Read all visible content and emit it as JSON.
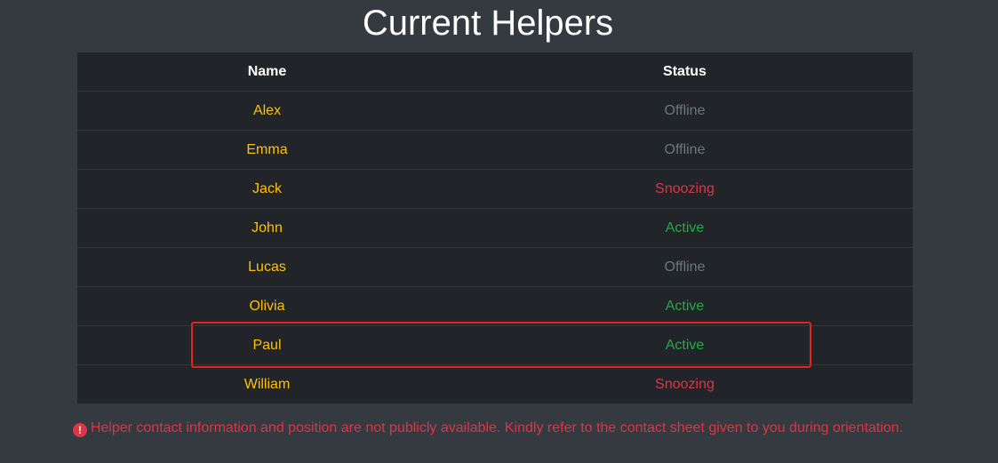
{
  "page": {
    "title": "Current Helpers"
  },
  "table": {
    "headers": {
      "name": "Name",
      "status": "Status"
    },
    "rows": [
      {
        "name": "Alex",
        "status": "Offline",
        "status_type": "offline"
      },
      {
        "name": "Emma",
        "status": "Offline",
        "status_type": "offline"
      },
      {
        "name": "Jack",
        "status": "Snoozing",
        "status_type": "snoozing"
      },
      {
        "name": "John",
        "status": "Active",
        "status_type": "active"
      },
      {
        "name": "Lucas",
        "status": "Offline",
        "status_type": "offline"
      },
      {
        "name": "Olivia",
        "status": "Active",
        "status_type": "active"
      },
      {
        "name": "Paul",
        "status": "Active",
        "status_type": "active",
        "highlighted": true
      },
      {
        "name": "William",
        "status": "Snoozing",
        "status_type": "snoozing"
      }
    ]
  },
  "notice": {
    "icon": "exclamation-circle-icon",
    "text": "Helper contact information and position are not publicly available. Kindly refer to the contact sheet given to you during orientation."
  },
  "colors": {
    "background": "#343a40",
    "table_background": "#212529",
    "name_text": "#ffc107",
    "status_offline": "#6c757d",
    "status_active": "#28a745",
    "status_snoozing": "#dc3545",
    "highlight_border": "#e8221b",
    "notice_text": "#dc3545"
  }
}
